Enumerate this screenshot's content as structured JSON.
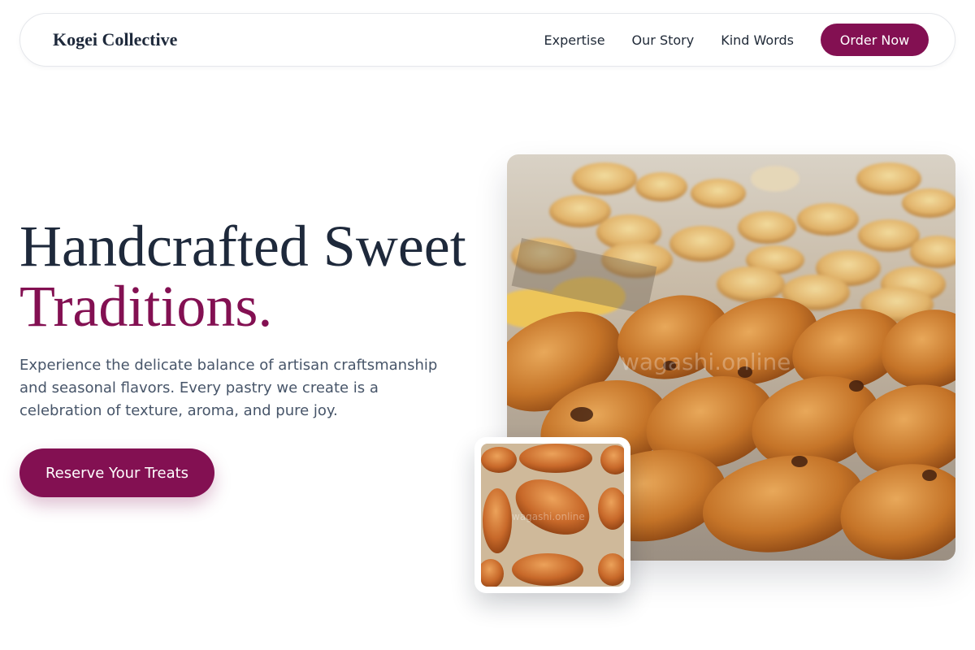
{
  "nav": {
    "brand": "Kogei Collective",
    "links": [
      "Expertise",
      "Our Story",
      "Kind Words"
    ],
    "cta": "Order Now"
  },
  "hero": {
    "title_line1": "Handcrafted Sweet",
    "title_line2": "Traditions.",
    "description": "Experience the delicate balance of artisan craftsmanship and seasonal flavors. Every pastry we create is a celebration of texture, aroma, and pure joy.",
    "cta": "Reserve Your Treats"
  },
  "images": {
    "main_watermark": "wagashi.online",
    "inset_watermark": "wagashi.online"
  },
  "colors": {
    "accent": "#831052",
    "heading": "#1e293b",
    "body_text": "#475569"
  }
}
